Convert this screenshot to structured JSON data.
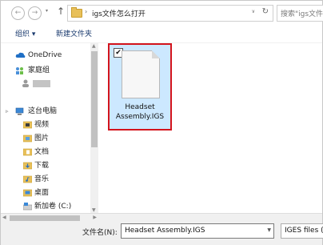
{
  "address_bar": {
    "back_glyph": "←",
    "forward_glyph": "→",
    "history_glyph": "▾",
    "up_glyph": "↑",
    "separator_glyph": "›",
    "path": "igs文件怎么打开",
    "dropdown_glyph": "∨",
    "refresh_glyph": "↻",
    "search_placeholder": "搜索\"igs文件怎么打开\""
  },
  "toolbar": {
    "organize_label": "组织 ▾",
    "new_folder_label": "新建文件夹"
  },
  "nav": {
    "onedrive": "OneDrive",
    "homegroup": "家庭组",
    "this_pc": "这台电脑",
    "items": [
      {
        "label": "视频",
        "icon": "video-folder-icon"
      },
      {
        "label": "图片",
        "icon": "pictures-folder-icon"
      },
      {
        "label": "文档",
        "icon": "documents-folder-icon"
      },
      {
        "label": "下载",
        "icon": "downloads-folder-icon"
      },
      {
        "label": "音乐",
        "icon": "music-folder-icon"
      },
      {
        "label": "桌面",
        "icon": "desktop-folder-icon"
      },
      {
        "label": "新加卷 (C:)",
        "icon": "drive-icon"
      }
    ]
  },
  "file": {
    "name_line1": "Headset",
    "name_line2": "Assembly.IGS",
    "checked_glyph": "✔"
  },
  "bottom": {
    "filename_label": "文件名(N):",
    "filename_value": "Headset Assembly.IGS",
    "filetype_value": "IGES files (*.igs"
  },
  "colors": {
    "selection_bg": "#cce8ff",
    "highlight_border": "#d4141d",
    "folder_yellow": "#e8c05a",
    "onedrive_blue": "#1f6fc5"
  }
}
